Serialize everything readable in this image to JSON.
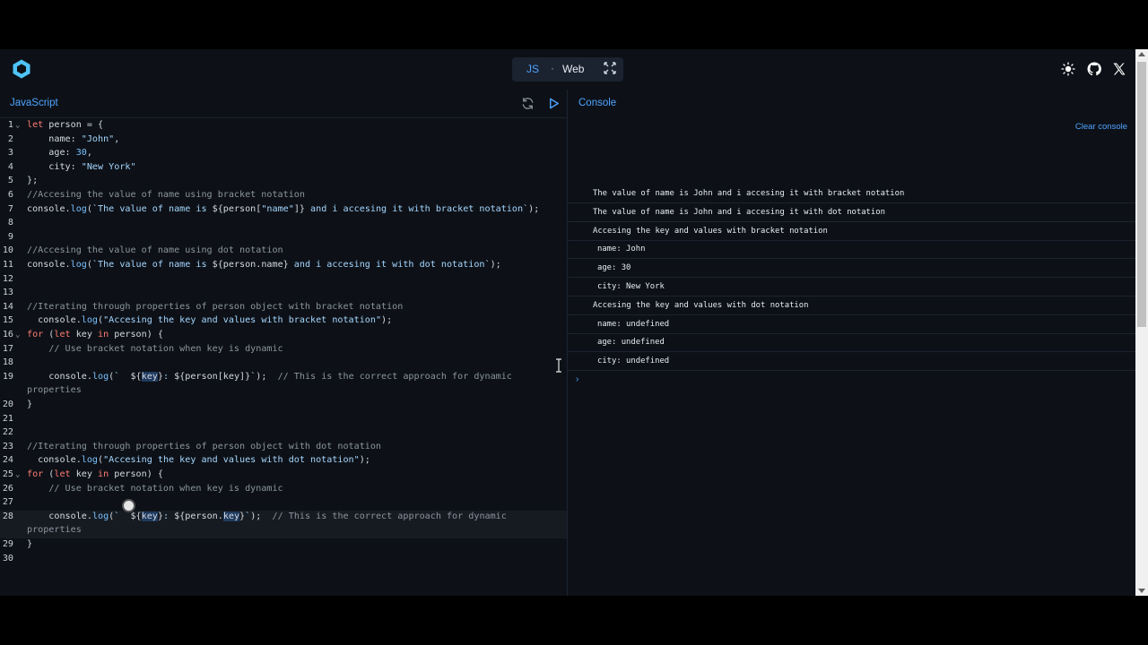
{
  "header": {
    "logo": "hexagon-logo",
    "modes": {
      "js": "JS",
      "sep": "·",
      "web": "Web"
    },
    "icons": [
      "sun-icon",
      "github-icon",
      "x-icon"
    ]
  },
  "editor": {
    "title": "JavaScript",
    "active_line": 28,
    "lines": [
      {
        "n": "1",
        "fold": true,
        "html": "<span class=\"kw\">let</span> person = {"
      },
      {
        "n": "2",
        "html": "    name: <span class=\"str\">\"John\"</span>,"
      },
      {
        "n": "3",
        "html": "    age: <span class=\"num\">30</span>,"
      },
      {
        "n": "4",
        "html": "    city: <span class=\"str\">\"New York\"</span>"
      },
      {
        "n": "5",
        "html": "};"
      },
      {
        "n": "6",
        "html": "<span class=\"cm\">//Accesing the value of name using bracket notation</span>"
      },
      {
        "n": "7",
        "html": "console.<span class=\"fn\">log</span>(<span class=\"str\">`The value of name is </span>${person[<span class=\"str\">\"name\"</span>]}<span class=\"str\"> and i accesing it with bracket notation`</span>);"
      },
      {
        "n": "8",
        "html": ""
      },
      {
        "n": "9",
        "html": ""
      },
      {
        "n": "10",
        "html": "<span class=\"cm\">//Accesing the value of name using dot notation</span>"
      },
      {
        "n": "11",
        "html": "console.<span class=\"fn\">log</span>(<span class=\"str\">`The value of name is </span>${person.name}<span class=\"str\"> and i accesing it with dot notation`</span>);"
      },
      {
        "n": "12",
        "html": ""
      },
      {
        "n": "13",
        "html": ""
      },
      {
        "n": "14",
        "html": "<span class=\"cm\">//Iterating through properties of person object with bracket notation</span>"
      },
      {
        "n": "15",
        "html": "  console.<span class=\"fn\">log</span>(<span class=\"str\">\"Accesing the key and values with bracket notation\"</span>);"
      },
      {
        "n": "16",
        "fold": true,
        "html": "<span class=\"kw\">for</span> (<span class=\"kw\">let</span> key <span class=\"kw\">in</span> person) {"
      },
      {
        "n": "17",
        "html": "    <span class=\"cm\">// Use bracket notation when key is dynamic</span>"
      },
      {
        "n": "18",
        "html": ""
      },
      {
        "n": "19",
        "html": "    console.<span class=\"fn\">log</span>(<span class=\"str\">`  </span>${<span class=\"hl\">key</span>}<span class=\"str\">: </span>${person[key]}<span class=\"str\">`</span>);  <span class=\"cm\">// This is the correct approach for dynamic</span>"
      },
      {
        "n": "",
        "html": "<span class=\"cm\">properties</span>"
      },
      {
        "n": "20",
        "html": "}"
      },
      {
        "n": "21",
        "html": ""
      },
      {
        "n": "22",
        "html": ""
      },
      {
        "n": "23",
        "html": "<span class=\"cm\">//Iterating through properties of person object with dot notation</span>"
      },
      {
        "n": "24",
        "html": "  console.<span class=\"fn\">log</span>(<span class=\"str\">\"Accesing the key and values with dot notation\"</span>);"
      },
      {
        "n": "25",
        "fold": true,
        "html": "<span class=\"kw\">for</span> (<span class=\"kw\">let</span> key <span class=\"kw\">in</span> person) {"
      },
      {
        "n": "26",
        "html": "    <span class=\"cm\">// Use bracket notation when key is dynamic</span>"
      },
      {
        "n": "27",
        "html": ""
      },
      {
        "n": "28",
        "html": "    console.<span class=\"fn\">log</span>(<span class=\"str\">`  </span>${<span class=\"hl\">key</span>}<span class=\"str\">: </span>${person.<span class=\"hl\">key</span>}<span class=\"str\">`</span>);  <span class=\"cm\">// This is the correct approach for dynamic</span>"
      },
      {
        "n": "",
        "html": "<span class=\"cm\">properties</span>"
      },
      {
        "n": "29",
        "html": "}"
      },
      {
        "n": "30",
        "html": ""
      }
    ]
  },
  "console": {
    "title": "Console",
    "clear_label": "Clear console",
    "prompt": "›",
    "logs": [
      {
        "text": "The value of name is John and i accesing it with bracket notation",
        "indent": false
      },
      {
        "text": "The value of name is John and i accesing it with dot notation",
        "indent": false
      },
      {
        "text": "Accesing the key and values with bracket notation",
        "indent": false
      },
      {
        "text": "name: John",
        "indent": true
      },
      {
        "text": "age: 30",
        "indent": true
      },
      {
        "text": "city: New York",
        "indent": true
      },
      {
        "text": "Accesing the key and values with dot notation",
        "indent": false
      },
      {
        "text": "name: undefined",
        "indent": true
      },
      {
        "text": "age: undefined",
        "indent": true
      },
      {
        "text": "city: undefined",
        "indent": true
      }
    ]
  }
}
